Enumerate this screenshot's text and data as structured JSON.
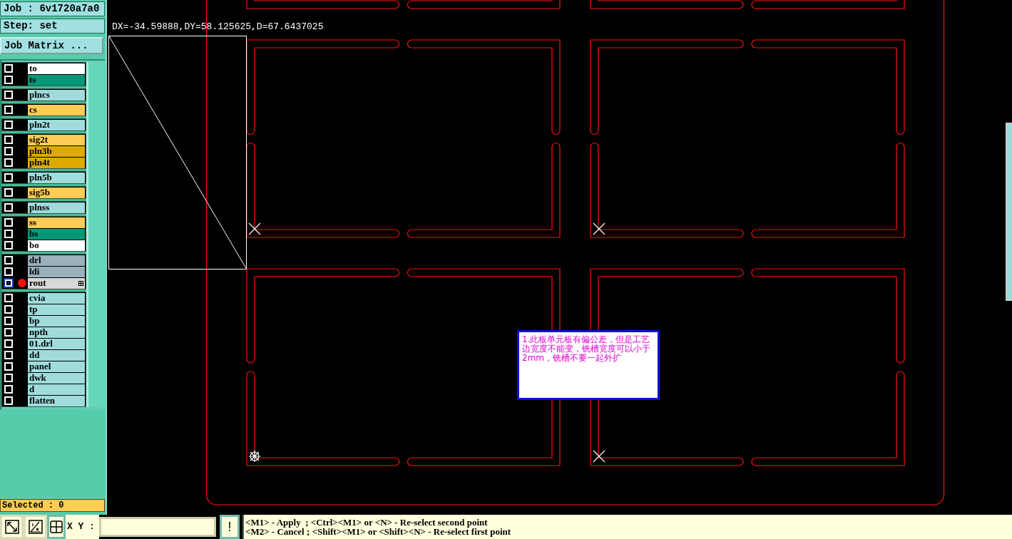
{
  "job": "Job : 6v1720a7a0",
  "step": "Step: set",
  "job_matrix_button": "Job Matrix ...",
  "layer_groups": [
    {
      "layers": [
        {
          "name": "to",
          "color": "#ffffff",
          "work": false
        },
        {
          "name": "ts",
          "color": "#009977",
          "work": false
        }
      ]
    },
    {
      "layers": [
        {
          "name": "plncs",
          "color": "#a0dcdc",
          "work": false
        }
      ]
    },
    {
      "layers": [
        {
          "name": "cs",
          "color": "#ffcc55",
          "work": false
        }
      ]
    },
    {
      "layers": [
        {
          "name": "pln2t",
          "color": "#a0dcdc",
          "work": false
        }
      ]
    },
    {
      "layers": [
        {
          "name": "sig2t",
          "color": "#ffcc55",
          "work": false
        },
        {
          "name": "pln3b",
          "color": "#ddaa00",
          "work": false
        },
        {
          "name": "pln4t",
          "color": "#ddaa00",
          "work": false
        }
      ]
    },
    {
      "layers": [
        {
          "name": "pln5b",
          "color": "#a0dcdc",
          "work": false
        }
      ]
    },
    {
      "layers": [
        {
          "name": "sig5b",
          "color": "#ffcc55",
          "work": false
        }
      ]
    },
    {
      "layers": [
        {
          "name": "plnss",
          "color": "#a0dcdc",
          "work": false
        }
      ]
    },
    {
      "layers": [
        {
          "name": "ss",
          "color": "#ffcc55",
          "work": false
        },
        {
          "name": "bs",
          "color": "#009977",
          "work": false
        },
        {
          "name": "bo",
          "color": "#ffffff",
          "work": false
        }
      ]
    },
    {
      "layers": [
        {
          "name": "drl",
          "color": "#9ab0bb",
          "work": false
        },
        {
          "name": "ldi",
          "color": "#9ab0bb",
          "work": false
        },
        {
          "name": "rout",
          "color": "#d8d8d8",
          "work": true
        }
      ]
    },
    {
      "layers": [
        {
          "name": "cvia",
          "color": "#a0dcdc",
          "work": false
        },
        {
          "name": "tp",
          "color": "#a0dcdc",
          "work": false
        },
        {
          "name": "bp",
          "color": "#a0dcdc",
          "work": false
        },
        {
          "name": "npth",
          "color": "#a0dcdc",
          "work": false
        },
        {
          "name": "01.drl",
          "color": "#a0dcdc",
          "work": false
        },
        {
          "name": "dd",
          "color": "#a0dcdc",
          "work": false
        },
        {
          "name": "panel",
          "color": "#a0dcdc",
          "work": false
        },
        {
          "name": "dwk",
          "color": "#a0dcdc",
          "work": false
        },
        {
          "name": "d",
          "color": "#a0dcdc",
          "work": false
        },
        {
          "name": "flatten",
          "color": "#a0dcdc",
          "work": false
        }
      ]
    }
  ],
  "selected_count": "Selected : 0",
  "measurement": "DX=-34.59888,DY=58.125625,D=67.6437025",
  "note": "1.此板单元板有偏公差，但是工艺边宽度不能变，铣槽宽度可以小于2mm，铣槽不要一起外扩",
  "xy_label": "X Y :",
  "apply_button": "!",
  "hints": [
    "<M1> - Apply  ; <Ctrl><M1> or <N> - Re-select second point",
    "<M2> - Cancel ; <Shift><M1> or <Shift><N> - Re-select first point"
  ]
}
